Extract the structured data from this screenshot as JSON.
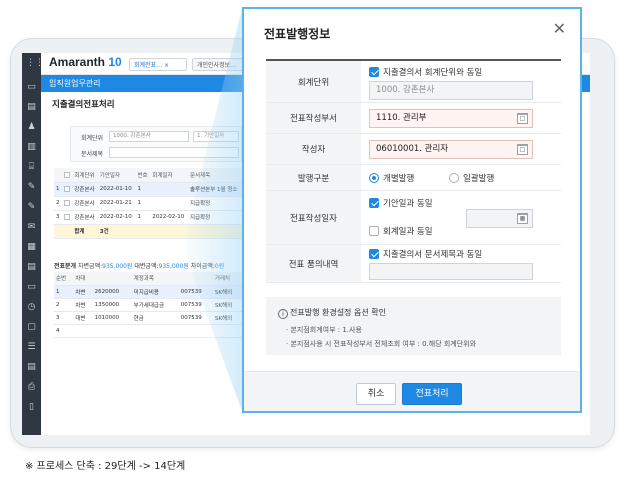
{
  "app": {
    "logo_text": "Amaranth",
    "logo_version": "10",
    "tabs": [
      "회계전표…  ×",
      "개인인사정보…"
    ],
    "menu_title": "임직원업무관리",
    "page_title": "지출결의전표처리"
  },
  "filter": {
    "unit_label": "회계단위",
    "unit_value": "1000. 강촌본사",
    "period_value": "1. 기안일자",
    "subject_label": "문서제목"
  },
  "upper_table": {
    "headers": [
      "",
      "회계단위",
      "기안일자",
      "번호",
      "회계일자",
      "문서제목"
    ],
    "rows": [
      [
        "1",
        "강촌본사",
        "2022-01-10",
        "1",
        "",
        "솔루션본부 1월 청소"
      ],
      [
        "2",
        "강촌본사",
        "2022-01-21",
        "1",
        "",
        "지급확정"
      ],
      [
        "3",
        "강촌본사",
        "2022-02-10",
        "1",
        "2022-02-10",
        "지급확정"
      ]
    ],
    "sum_label": "합계",
    "sum_count": "3건"
  },
  "lower_section": {
    "title": "전표분개",
    "debit_label": "차변금액:",
    "debit_value": "935,000원",
    "credit_label": "대변금액:",
    "credit_value": "935,000원",
    "diff_label": "차이금액:",
    "diff_value": "0원",
    "headers": [
      "순번",
      "차대",
      "",
      "계정과목",
      "",
      "거래처"
    ],
    "rows": [
      [
        "1",
        "차변",
        "2620000",
        "미지급비용",
        "007539",
        "SK해외"
      ],
      [
        "2",
        "차변",
        "1350000",
        "부가세대급금",
        "007539",
        "SK해외"
      ],
      [
        "3",
        "대변",
        "1010000",
        "현금",
        "007539",
        "SK해외"
      ],
      [
        "4",
        "",
        "",
        "",
        "",
        ""
      ]
    ]
  },
  "dialog": {
    "title": "전표발행정보",
    "close_glyph": "✕",
    "unit": {
      "label": "회계단위",
      "same_check_label": "지출결의서 회계단위와 동일",
      "value": "1000. 강촌본사"
    },
    "writer_dept": {
      "label": "전표작성부서",
      "value": "1110. 관리부"
    },
    "writer": {
      "label": "작성자",
      "value": "06010001. 관리자"
    },
    "issue_type": {
      "label": "발행구분",
      "options": [
        "개별발행",
        "일괄발행"
      ],
      "selected": "개별발행"
    },
    "write_date": {
      "label": "전표작성일자",
      "opt_draft": "기안일과 동일",
      "opt_account": "회계일과 동일"
    },
    "memo": {
      "label": "전표 품의내역",
      "check_label": "지출결의서 문서제목과 동일"
    },
    "notice": {
      "title": "전표발행 환경설정 옵션 확인",
      "line1": "· 본지점회계여부 : 1.사용",
      "line2": "· 본지점사용 시 전표작성부서 전체조회 여부 : 0.해당 회계단위와"
    },
    "cancel_label": "취소",
    "ok_label": "전표처리"
  },
  "caption": "※ 프로세스 단축 : 29단계 -> 14단계",
  "colors": {
    "accent": "#1e88e5",
    "dialog_border": "#5ab3ea",
    "rail": "#2f3742"
  }
}
